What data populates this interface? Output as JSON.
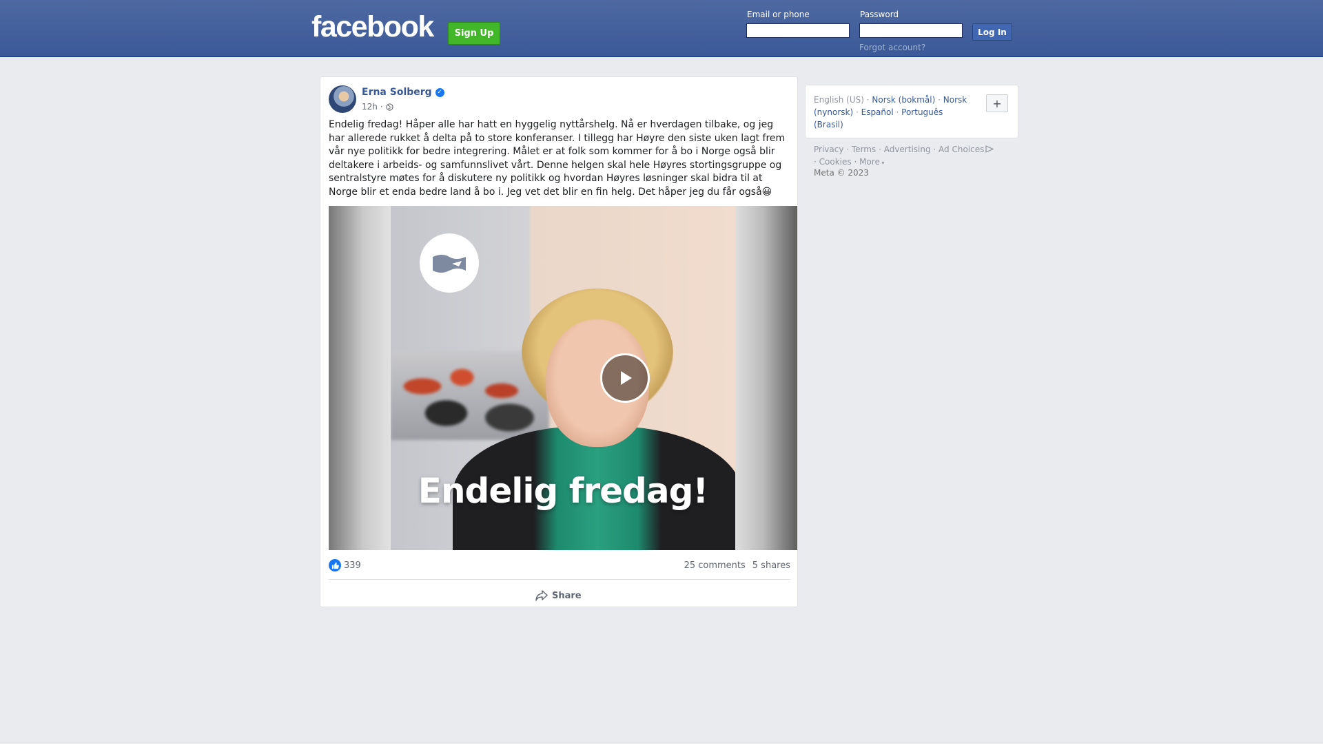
{
  "header": {
    "logo": "facebook",
    "signup_label": "Sign Up",
    "email_label": "Email or phone",
    "password_label": "Password",
    "login_label": "Log In",
    "forgot_label": "Forgot account?",
    "background": "#3b5998",
    "signup_color": "#42b72a"
  },
  "post": {
    "author": "Erna Solberg",
    "verified": true,
    "time": "12h",
    "separator": "·",
    "privacy_icon": "globe-icon",
    "text": "Endelig fredag! Håper alle har hatt en hyggelig nyttårshelg. Nå er hverdagen tilbake, og jeg har allerede rukket å delta på to store konferanser. I tillegg har Høyre den siste uken lagt frem vår nye politikk for bedre integrering. Målet er at folk som kommer for å bo i Norge også blir deltakere i arbeids- og samfunnslivet vårt. Denne helgen skal hele Høyres stortingsgruppe og sentralstyre møtes for å diskutere ny politikk og hvordan Høyres løsninger skal bidra til at Norge blir et enda bedre land å bo i. Jeg vet det blir en fin helg. Det håper jeg du får også😀",
    "video_overlay_text": "Endelig fredag!",
    "likes": "339",
    "comments": "25 comments",
    "shares": "5 shares",
    "share_label": "Share"
  },
  "sidebar": {
    "languages": [
      {
        "label": "English (US)",
        "current": true
      },
      {
        "label": "Norsk (bokmål)",
        "current": false
      },
      {
        "label": "Norsk (nynorsk)",
        "current": false
      },
      {
        "label": "Español",
        "current": false
      },
      {
        "label": "Português (Brasil)",
        "current": false
      }
    ],
    "add_language": "+",
    "footer_links": [
      "Privacy",
      "Terms",
      "Advertising",
      "Ad Choices",
      "Cookies",
      "More"
    ],
    "copyright": "Meta © 2023"
  }
}
